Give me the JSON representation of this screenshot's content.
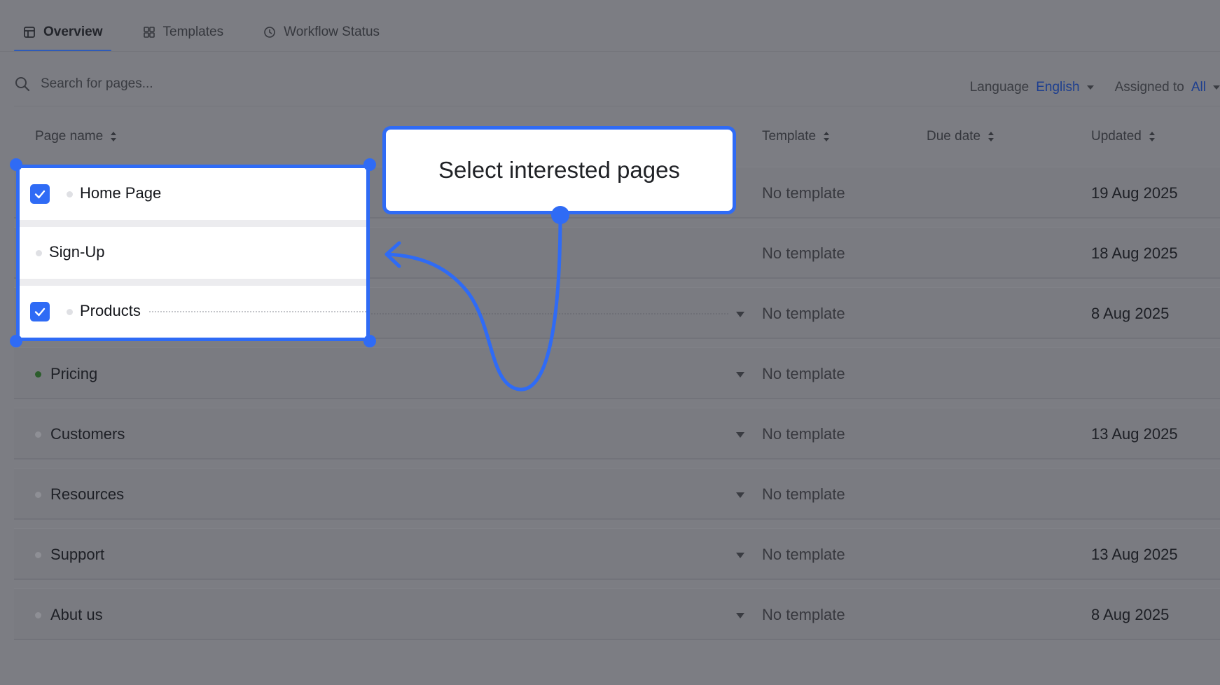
{
  "tabs": [
    {
      "label": "Overview",
      "icon": "window-icon",
      "active": true
    },
    {
      "label": "Templates",
      "icon": "grid-icon",
      "active": false
    },
    {
      "label": "Workflow Status",
      "icon": "clock-icon",
      "active": false
    }
  ],
  "search": {
    "placeholder": "Search for pages..."
  },
  "filters": {
    "language_label": "Language",
    "language_value": "English",
    "assigned_label": "Assigned to",
    "assigned_value": "All"
  },
  "columns": {
    "page_name": "Page name",
    "template": "Template",
    "due_date": "Due date",
    "updated": "Updated"
  },
  "rows": [
    {
      "name": "Home Page",
      "template": "No template",
      "updated": "19 Aug 2025",
      "checked": true
    },
    {
      "name": "Sign-Up",
      "template": "No template",
      "updated": "18 Aug 2025",
      "checked": false
    },
    {
      "name": "Products",
      "template": "No template",
      "updated": "8 Aug 2025",
      "checked": true
    },
    {
      "name": "Pricing",
      "template": "No template",
      "updated": "",
      "status": "green"
    },
    {
      "name": "Customers",
      "template": "No template",
      "updated": "13 Aug 2025"
    },
    {
      "name": "Resources",
      "template": "No template",
      "updated": ""
    },
    {
      "name": "Support",
      "template": "No template",
      "updated": "13 Aug 2025"
    },
    {
      "name": "Abut us",
      "template": "No template",
      "updated": "8 Aug 2025"
    }
  ],
  "callout": {
    "text": "Select interested pages"
  },
  "colors": {
    "accent": "#2f6bf5",
    "overlay": "#7c7d83",
    "link": "#1e3f8f"
  }
}
